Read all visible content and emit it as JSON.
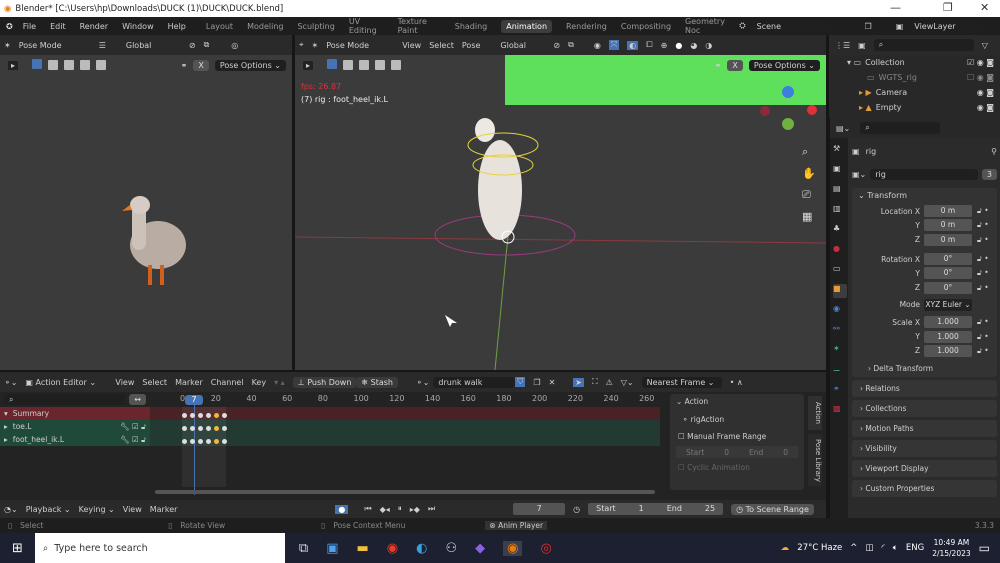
{
  "window": {
    "title": "Blender* [C:\\Users\\hp\\Downloads\\DUCK (1)\\DUCK\\DUCK.blend]",
    "minimize": "—",
    "maximize": "❐",
    "close": "✕"
  },
  "menu": [
    "File",
    "Edit",
    "Render",
    "Window",
    "Help"
  ],
  "workspaces": [
    "Layout",
    "Modeling",
    "Sculpting",
    "UV Editing",
    "Texture Paint",
    "Shading",
    "Animation",
    "Rendering",
    "Compositing",
    "Geometry Noc"
  ],
  "active_workspace": "Animation",
  "scene": "Scene",
  "view_layer": "ViewLayer",
  "left_viewport": {
    "mode": "Pose Mode",
    "orientation": "Global",
    "pose_options": "Pose Options",
    "x_label": "X"
  },
  "center_viewport": {
    "mode": "Pose Mode",
    "menus": [
      "View",
      "Select",
      "Pose"
    ],
    "orientation": "Global",
    "pose_options": "Pose Options",
    "fps": "fps: 26.87",
    "info": "(7) rig : foot_heel_ik.L",
    "x_label": "X"
  },
  "outliner": {
    "items": [
      {
        "name": "Collection"
      },
      {
        "name": "WGTS_rig"
      },
      {
        "name": "Camera"
      },
      {
        "name": "Empty"
      }
    ]
  },
  "properties": {
    "object": "rig",
    "data_name": "rig",
    "users": "3",
    "transform": "Transform",
    "location": {
      "label": "Location X",
      "x": "0 m",
      "y": "0 m",
      "z": "0 m"
    },
    "rotation": {
      "label": "Rotation X",
      "x": "0°",
      "y": "0°",
      "z": "0°"
    },
    "mode_label": "Mode",
    "mode": "XYZ Euler",
    "scale": {
      "label": "Scale X",
      "x": "1.000",
      "y": "1.000",
      "z": "1.000"
    },
    "axis": {
      "y": "Y",
      "z": "Z"
    },
    "delta": "Delta Transform",
    "panels": [
      "Relations",
      "Collections",
      "Motion Paths",
      "Visibility",
      "Viewport Display",
      "Custom Properties"
    ],
    "version": "3.3.3"
  },
  "action_editor": {
    "mode": "Action Editor",
    "menus": [
      "View",
      "Select",
      "Marker",
      "Channel",
      "Key"
    ],
    "push_down": "Push Down",
    "stash": "Stash",
    "action": "drunk walk",
    "snap": "Nearest Frame",
    "ticks": [
      "0",
      "20",
      "40",
      "60",
      "80",
      "100",
      "120",
      "140",
      "160",
      "180",
      "200",
      "220",
      "240",
      "260"
    ],
    "current_frame": "7",
    "channels": [
      "Summary",
      "toe.L",
      "foot_heel_ik.L"
    ],
    "sidebar": {
      "panel": "Action",
      "action_name": "rigAction",
      "manual_range": "Manual Frame Range",
      "start_label": "Start",
      "start": "0",
      "end_label": "End",
      "end": "0",
      "cyclic": "Cyclic Animation",
      "tabs": [
        "Action",
        "Pose Library"
      ]
    }
  },
  "timeline": {
    "menus": [
      "Playback",
      "Keying",
      "View",
      "Marker"
    ],
    "frame": "7",
    "start_label": "Start",
    "start": "1",
    "end_label": "End",
    "end": "25",
    "scene_range": "To Scene Range"
  },
  "status": {
    "select": "Select",
    "rotate": "Rotate View",
    "context": "Pose Context Menu",
    "anim_player": "Anim Player"
  },
  "taskbar": {
    "search": "Type here to search",
    "weather": "27°C  Haze",
    "lang": "ENG",
    "time": "10:49 AM",
    "date": "2/15/2023"
  }
}
